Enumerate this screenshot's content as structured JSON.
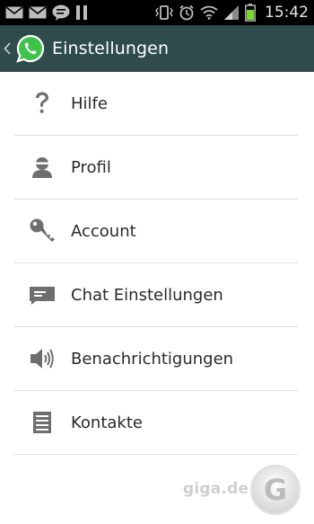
{
  "status_bar": {
    "time": "15:42",
    "left_icons": [
      "mail-icon",
      "mail-icon",
      "chat-bubble-icon",
      "pause-icon"
    ],
    "right_icons": [
      "vibrate-icon",
      "alarm-icon",
      "wifi-icon",
      "signal-icon",
      "battery-icon"
    ],
    "battery_color": "#7bd832"
  },
  "action_bar": {
    "title": "Einstellungen",
    "background": "#2f4b4b",
    "logo_color": "#3fc24a"
  },
  "settings": {
    "items": [
      {
        "label": "Hilfe",
        "icon": "help-icon"
      },
      {
        "label": "Profil",
        "icon": "profile-icon"
      },
      {
        "label": "Account",
        "icon": "key-icon"
      },
      {
        "label": "Chat Einstellungen",
        "icon": "chat-settings-icon"
      },
      {
        "label": "Benachrichtigungen",
        "icon": "speaker-icon"
      },
      {
        "label": "Kontakte",
        "icon": "contacts-icon"
      }
    ]
  },
  "watermark": {
    "text": "giga.de",
    "logo_letter": "G"
  }
}
